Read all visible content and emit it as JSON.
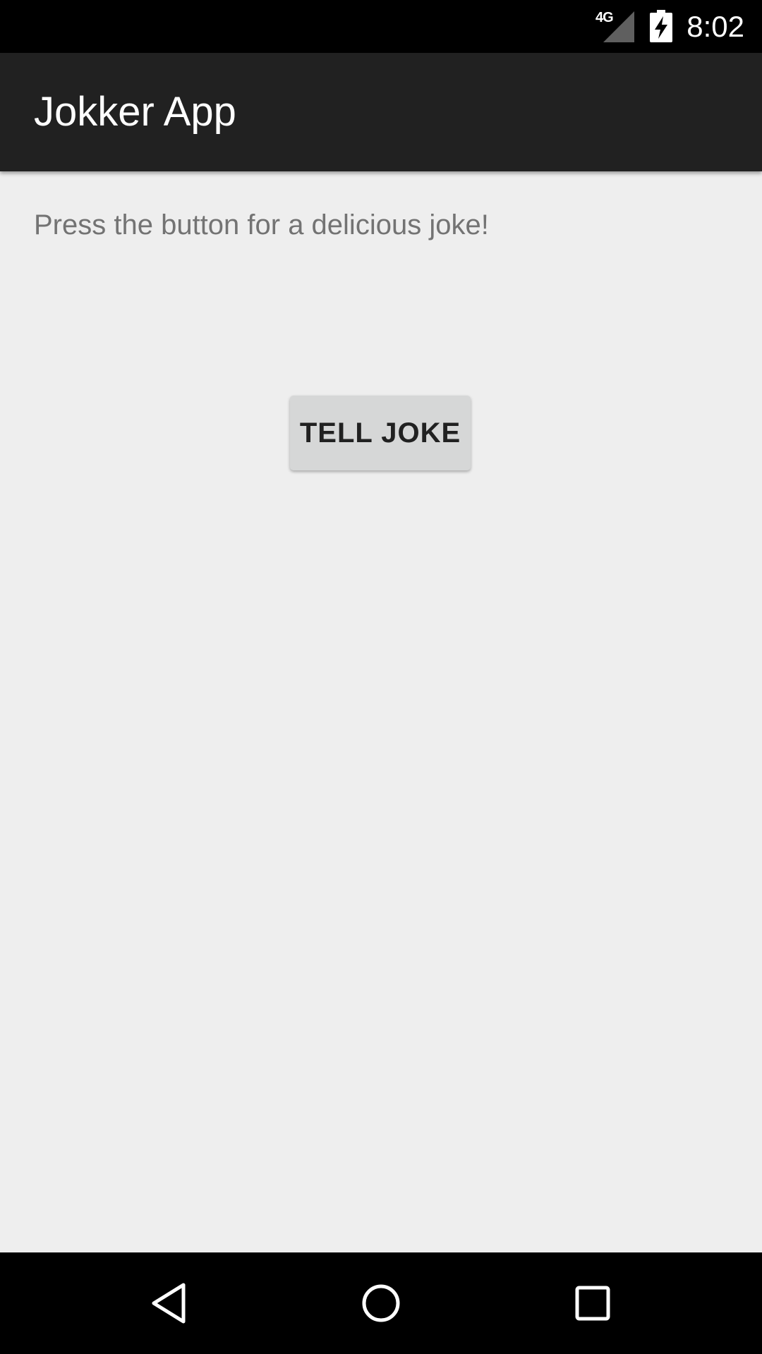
{
  "status_bar": {
    "network": "4G",
    "time": "8:02",
    "icons": [
      "signal-icon",
      "battery-charging-icon"
    ]
  },
  "app_bar": {
    "title": "Jokker App"
  },
  "main": {
    "instructions": "Press the button for a delicious joke!",
    "tell_joke_label": "TELL JOKE"
  },
  "nav_bar": {
    "icons": [
      "back-icon",
      "home-icon",
      "recents-icon"
    ]
  },
  "colors": {
    "status_bar": "#000000",
    "app_bar": "#212121",
    "background": "#eeeeee",
    "button": "#d6d7d7",
    "button_text": "#212121",
    "instruction_text": "#737373"
  }
}
